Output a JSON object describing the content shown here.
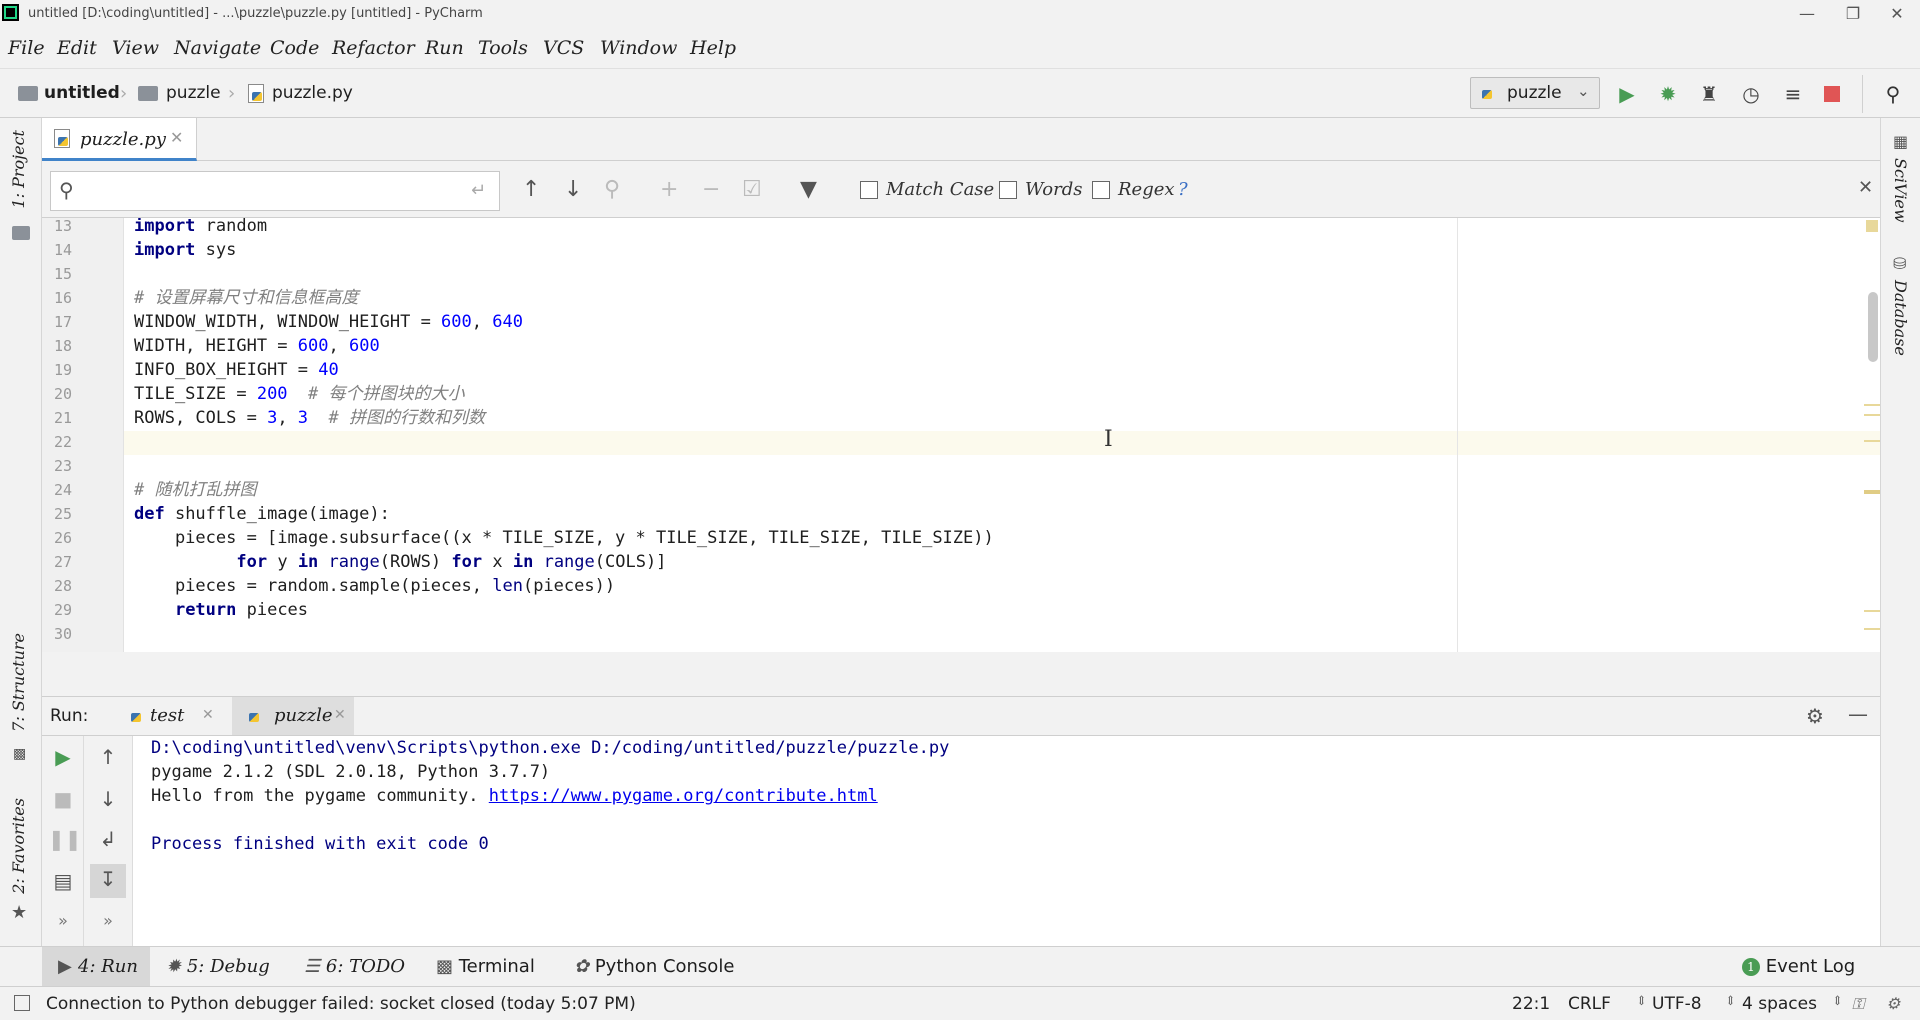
{
  "window": {
    "title": "untitled [D:\\coding\\untitled] - ...\\puzzle\\puzzle.py [untitled] - PyCharm"
  },
  "menu": [
    "File",
    "Edit",
    "View",
    "Navigate",
    "Code",
    "Refactor",
    "Run",
    "Tools",
    "VCS",
    "Window",
    "Help"
  ],
  "breadcrumb": {
    "project": "untitled",
    "folder": "puzzle",
    "file": "puzzle.py"
  },
  "run_config": {
    "name": "puzzle"
  },
  "left_tools": {
    "project": "1: Project",
    "structure": "7: Structure",
    "favorites": "2: Favorites"
  },
  "right_tools": {
    "sciview": "SciView",
    "database": "Database"
  },
  "editor_tab": {
    "label": "puzzle.py"
  },
  "find": {
    "match_case": "Match Case",
    "words": "Words",
    "regex": "Regex",
    "help": "?"
  },
  "code": {
    "line_numbers": [
      "13",
      "14",
      "15",
      "16",
      "17",
      "18",
      "19",
      "20",
      "21",
      "22",
      "23",
      "24",
      "25",
      "26",
      "27",
      "28",
      "29",
      "30"
    ],
    "l13": "random",
    "l14": "sys",
    "l16": "# 设置屏幕尺寸和信息框高度",
    "l17a": "WINDOW_WIDTH, WINDOW_HEIGHT = ",
    "l17b": "600",
    "l17c": "640",
    "l18a": "WIDTH, HEIGHT = ",
    "l18b": "600",
    "l18c": "600",
    "l19a": "INFO_BOX_HEIGHT = ",
    "l19b": "40",
    "l20a": "TILE_SIZE = ",
    "l20b": "200",
    "l20c": "# 每个拼图块的大小",
    "l21a": "ROWS, COLS = ",
    "l21b": "3",
    "l21c": "3",
    "l21d": "# 拼图的行数和列数",
    "l24": "# 随机打乱拼图",
    "l25": " shuffle_image(image):",
    "l26": "    pieces = [image.subsurface((x * TILE_SIZE, y * TILE_SIZE, TILE_SIZE, TILE_SIZE))",
    "l27a": "y ",
    "l27b": "(ROWS) ",
    "l27c": "x ",
    "l27d": "(COLS)]",
    "l28a": "    pieces = random.sample(pieces, ",
    "l28b": "(pieces))",
    "l29": " pieces"
  },
  "run_panel": {
    "label": "Run:",
    "tabs": [
      "test",
      "puzzle"
    ],
    "console": [
      "D:\\coding\\untitled\\venv\\Scripts\\python.exe D:/coding/untitled/puzzle/puzzle.py",
      "pygame 2.1.2 (SDL 2.0.18, Python 3.7.7)",
      "Hello from the pygame community. ",
      "https://www.pygame.org/contribute.html",
      "Process finished with exit code 0"
    ]
  },
  "bottom_tabs": [
    "4: Run",
    "5: Debug",
    "6: TODO",
    "Terminal",
    "Python Console"
  ],
  "event_log": {
    "label": "Event Log",
    "count": "1"
  },
  "status": {
    "message": "Connection to Python debugger failed: socket closed (today 5:07 PM)",
    "position": "22:1",
    "line_sep": "CRLF",
    "encoding": "UTF-8",
    "indent": "4 spaces"
  },
  "colors": {
    "accent": "#4083c9",
    "run_green": "#499c54",
    "stop_red": "#e05555",
    "keyword": "#000080",
    "number": "#0000ff",
    "comment": "#808080"
  }
}
